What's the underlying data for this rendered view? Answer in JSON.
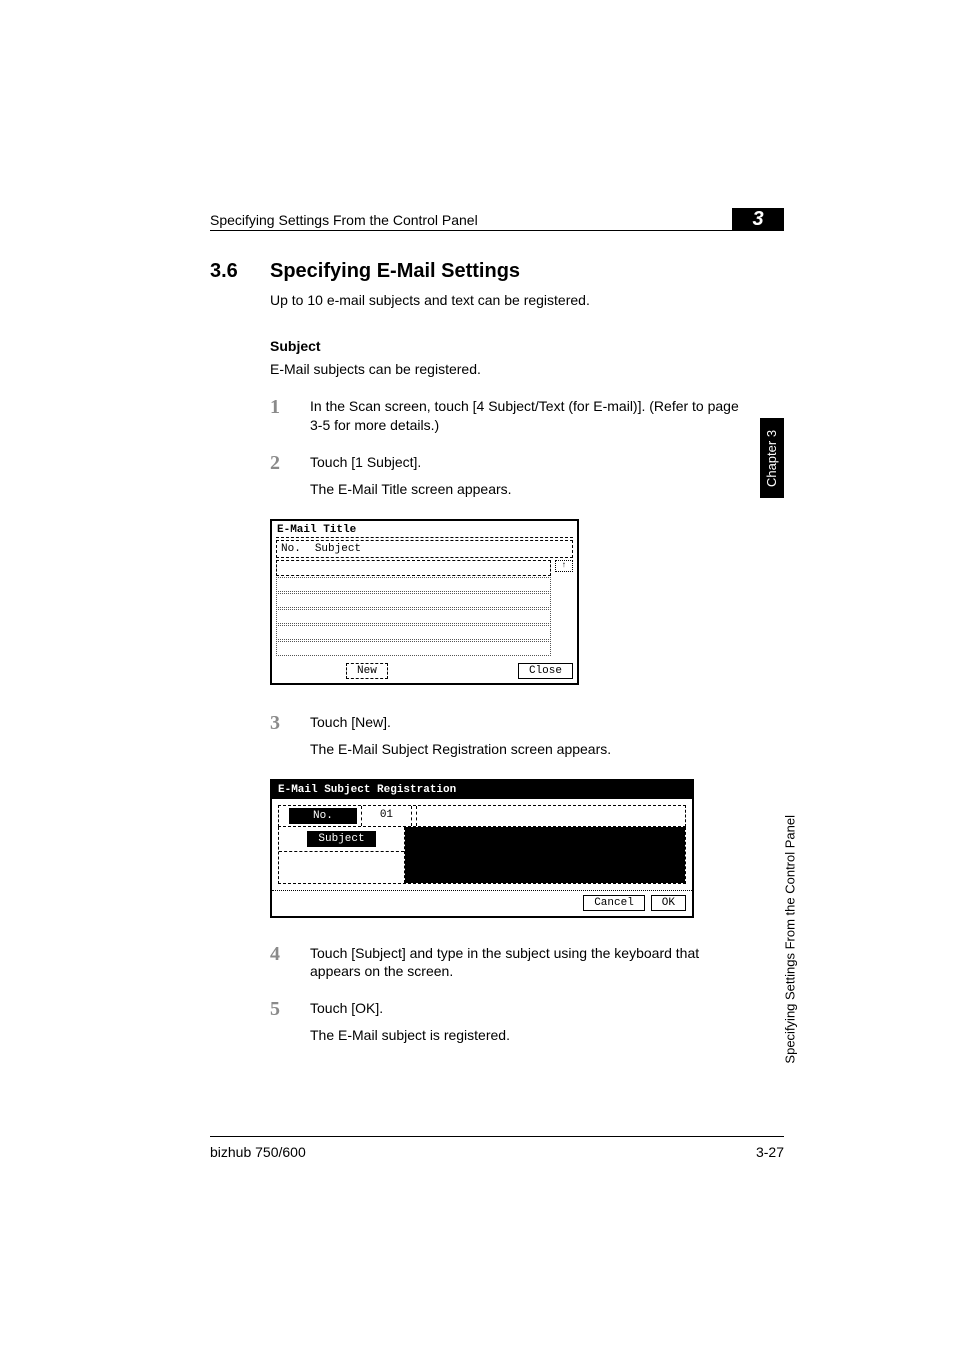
{
  "header": {
    "running_head": "Specifying Settings From the Control Panel",
    "chapter_mark": "3"
  },
  "section": {
    "number": "3.6",
    "title": "Specifying E-Mail Settings",
    "intro": "Up to 10 e-mail subjects and text can be registered."
  },
  "subsection": {
    "title": "Subject",
    "intro": "E-Mail subjects can be registered."
  },
  "steps": {
    "s1": {
      "num": "1",
      "text": "In the Scan screen, touch [4 Subject/Text (for E-mail)]. (Refer to page 3-5 for more details.)"
    },
    "s2": {
      "num": "2",
      "text": "Touch [1 Subject].",
      "result": "The E-Mail Title screen appears."
    },
    "s3": {
      "num": "3",
      "text": "Touch [New].",
      "result": "The E-Mail Subject Registration screen appears."
    },
    "s4": {
      "num": "4",
      "text": "Touch [Subject] and type in the subject using the keyboard that appears on the screen."
    },
    "s5": {
      "num": "5",
      "text": "Touch [OK].",
      "result": "The E-Mail subject is registered."
    }
  },
  "screenshot1": {
    "title": "E-Mail Title",
    "col_no": "No.",
    "col_subject": "Subject",
    "scroll_up": "↑",
    "btn_new": "New",
    "btn_close": "Close"
  },
  "screenshot2": {
    "title": "E-Mail Subject Registration",
    "no_label": "No.",
    "no_value": "01",
    "subject_btn": "Subject",
    "btn_cancel": "Cancel",
    "btn_ok": "OK"
  },
  "side": {
    "chapter": "Chapter 3",
    "text": "Specifying Settings From the Control Panel"
  },
  "footer": {
    "left": "bizhub 750/600",
    "right": "3-27"
  }
}
